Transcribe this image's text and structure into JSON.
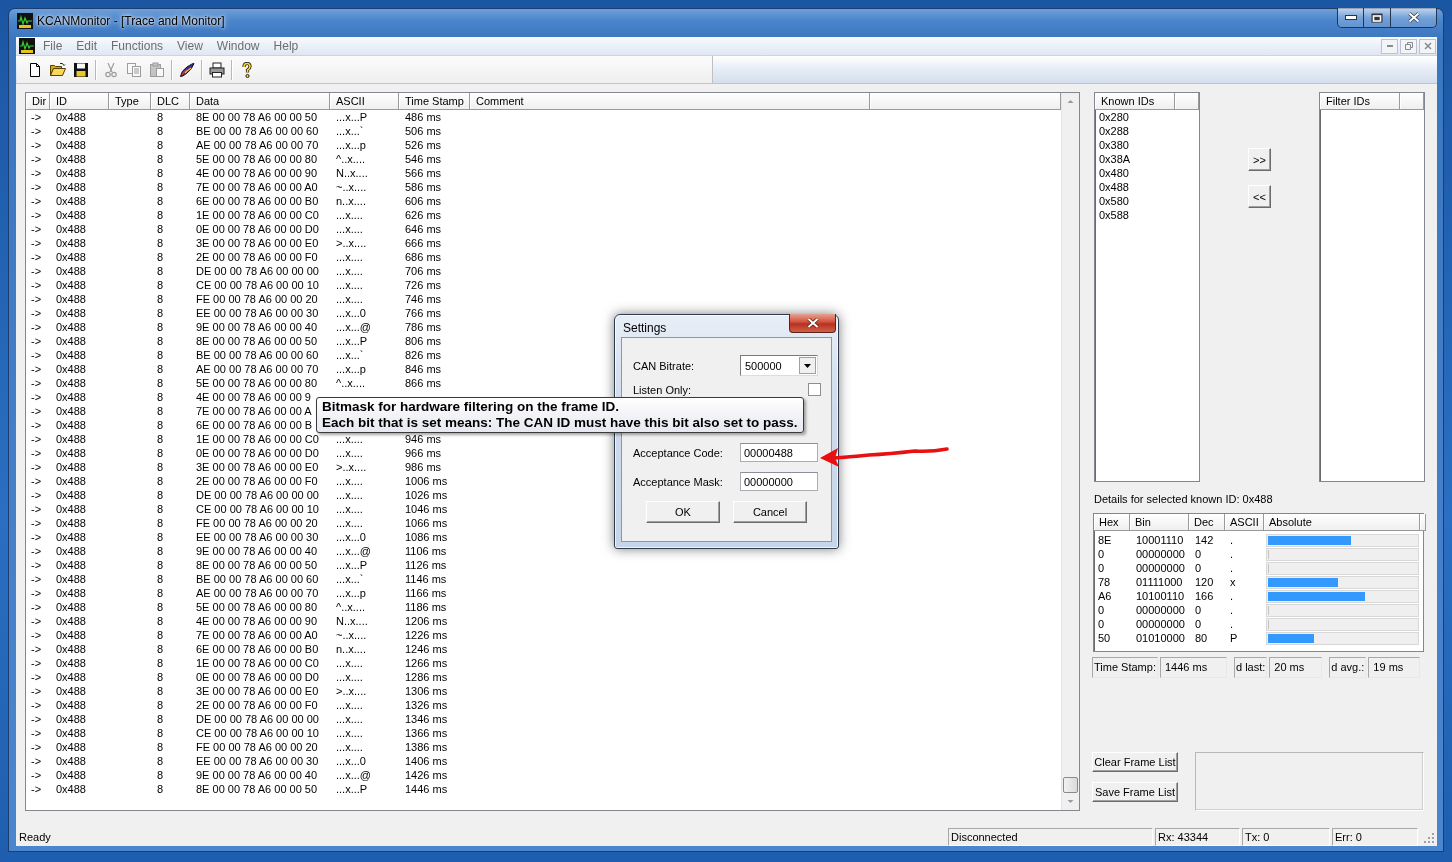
{
  "window": {
    "title": "KCANMonitor - [Trace and Monitor]"
  },
  "menu": [
    "File",
    "Edit",
    "Functions",
    "View",
    "Window",
    "Help"
  ],
  "toolbar": {
    "groups": [
      {
        "buttons": [
          {
            "disabled": false
          },
          {
            "disabled": false
          },
          {
            "disabled": false
          }
        ]
      },
      {
        "buttons": [
          {
            "disabled": true
          },
          {
            "disabled": true
          },
          {
            "disabled": true
          }
        ]
      },
      {
        "buttons": [
          {
            "disabled": false
          }
        ]
      },
      {
        "buttons": [
          {
            "disabled": false
          }
        ]
      },
      {
        "buttons": [
          {
            "disabled": false
          }
        ]
      }
    ]
  },
  "trace": {
    "columns": [
      "Dir",
      "ID",
      "Type",
      "DLC",
      "Data",
      "ASCII",
      "Time Stamp",
      "Comment"
    ],
    "rows": [
      {
        "dir": "->",
        "id": "0x488",
        "dlc": "8",
        "data": "8E 00 00 78 A6 00 00 50",
        "ascii": "...x...P",
        "time": "486 ms"
      },
      {
        "dir": "->",
        "id": "0x488",
        "dlc": "8",
        "data": "BE 00 00 78 A6 00 00 60",
        "ascii": "...x...`",
        "time": "506 ms"
      },
      {
        "dir": "->",
        "id": "0x488",
        "dlc": "8",
        "data": "AE 00 00 78 A6 00 00 70",
        "ascii": "...x...p",
        "time": "526 ms"
      },
      {
        "dir": "->",
        "id": "0x488",
        "dlc": "8",
        "data": "5E 00 00 78 A6 00 00 80",
        "ascii": "^..x....",
        "time": "546 ms"
      },
      {
        "dir": "->",
        "id": "0x488",
        "dlc": "8",
        "data": "4E 00 00 78 A6 00 00 90",
        "ascii": "N..x....",
        "time": "566 ms"
      },
      {
        "dir": "->",
        "id": "0x488",
        "dlc": "8",
        "data": "7E 00 00 78 A6 00 00 A0",
        "ascii": "~..x....",
        "time": "586 ms"
      },
      {
        "dir": "->",
        "id": "0x488",
        "dlc": "8",
        "data": "6E 00 00 78 A6 00 00 B0",
        "ascii": "n..x....",
        "time": "606 ms"
      },
      {
        "dir": "->",
        "id": "0x488",
        "dlc": "8",
        "data": "1E 00 00 78 A6 00 00 C0",
        "ascii": "...x....",
        "time": "626 ms"
      },
      {
        "dir": "->",
        "id": "0x488",
        "dlc": "8",
        "data": "0E 00 00 78 A6 00 00 D0",
        "ascii": "...x....",
        "time": "646 ms"
      },
      {
        "dir": "->",
        "id": "0x488",
        "dlc": "8",
        "data": "3E 00 00 78 A6 00 00 E0",
        "ascii": ">..x....",
        "time": "666 ms"
      },
      {
        "dir": "->",
        "id": "0x488",
        "dlc": "8",
        "data": "2E 00 00 78 A6 00 00 F0",
        "ascii": "...x....",
        "time": "686 ms"
      },
      {
        "dir": "->",
        "id": "0x488",
        "dlc": "8",
        "data": "DE 00 00 78 A6 00 00 00",
        "ascii": "...x....",
        "time": "706 ms"
      },
      {
        "dir": "->",
        "id": "0x488",
        "dlc": "8",
        "data": "CE 00 00 78 A6 00 00 10",
        "ascii": "...x....",
        "time": "726 ms"
      },
      {
        "dir": "->",
        "id": "0x488",
        "dlc": "8",
        "data": "FE 00 00 78 A6 00 00 20",
        "ascii": "...x....",
        "time": "746 ms"
      },
      {
        "dir": "->",
        "id": "0x488",
        "dlc": "8",
        "data": "EE 00 00 78 A6 00 00 30",
        "ascii": "...x...0",
        "time": "766 ms"
      },
      {
        "dir": "->",
        "id": "0x488",
        "dlc": "8",
        "data": "9E 00 00 78 A6 00 00 40",
        "ascii": "...x...@",
        "time": "786 ms"
      },
      {
        "dir": "->",
        "id": "0x488",
        "dlc": "8",
        "data": "8E 00 00 78 A6 00 00 50",
        "ascii": "...x...P",
        "time": "806 ms"
      },
      {
        "dir": "->",
        "id": "0x488",
        "dlc": "8",
        "data": "BE 00 00 78 A6 00 00 60",
        "ascii": "...x...`",
        "time": "826 ms"
      },
      {
        "dir": "->",
        "id": "0x488",
        "dlc": "8",
        "data": "AE 00 00 78 A6 00 00 70",
        "ascii": "...x...p",
        "time": "846 ms"
      },
      {
        "dir": "->",
        "id": "0x488",
        "dlc": "8",
        "data": "5E 00 00 78 A6 00 00 80",
        "ascii": "^..x....",
        "time": "866 ms"
      },
      {
        "dir": "->",
        "id": "0x488",
        "dlc": "8",
        "data": "4E 00 00 78 A6 00 00 9"
      },
      {
        "dir": "->",
        "id": "0x488",
        "dlc": "8",
        "data": "7E 00 00 78 A6 00 00 A"
      },
      {
        "dir": "->",
        "id": "0x488",
        "dlc": "8",
        "data": "6E 00 00 78 A6 00 00 B"
      },
      {
        "dir": "->",
        "id": "0x488",
        "dlc": "8",
        "data": "1E 00 00 78 A6 00 00 C0",
        "ascii": "...x....",
        "time": "946 ms"
      },
      {
        "dir": "->",
        "id": "0x488",
        "dlc": "8",
        "data": "0E 00 00 78 A6 00 00 D0",
        "ascii": "...x....",
        "time": "966 ms"
      },
      {
        "dir": "->",
        "id": "0x488",
        "dlc": "8",
        "data": "3E 00 00 78 A6 00 00 E0",
        "ascii": ">..x....",
        "time": "986 ms"
      },
      {
        "dir": "->",
        "id": "0x488",
        "dlc": "8",
        "data": "2E 00 00 78 A6 00 00 F0",
        "ascii": "...x....",
        "time": "1006 ms"
      },
      {
        "dir": "->",
        "id": "0x488",
        "dlc": "8",
        "data": "DE 00 00 78 A6 00 00 00",
        "ascii": "...x....",
        "time": "1026 ms"
      },
      {
        "dir": "->",
        "id": "0x488",
        "dlc": "8",
        "data": "CE 00 00 78 A6 00 00 10",
        "ascii": "...x....",
        "time": "1046 ms"
      },
      {
        "dir": "->",
        "id": "0x488",
        "dlc": "8",
        "data": "FE 00 00 78 A6 00 00 20",
        "ascii": "...x....",
        "time": "1066 ms"
      },
      {
        "dir": "->",
        "id": "0x488",
        "dlc": "8",
        "data": "EE 00 00 78 A6 00 00 30",
        "ascii": "...x...0",
        "time": "1086 ms"
      },
      {
        "dir": "->",
        "id": "0x488",
        "dlc": "8",
        "data": "9E 00 00 78 A6 00 00 40",
        "ascii": "...x...@",
        "time": "1106 ms"
      },
      {
        "dir": "->",
        "id": "0x488",
        "dlc": "8",
        "data": "8E 00 00 78 A6 00 00 50",
        "ascii": "...x...P",
        "time": "1126 ms"
      },
      {
        "dir": "->",
        "id": "0x488",
        "dlc": "8",
        "data": "BE 00 00 78 A6 00 00 60",
        "ascii": "...x...`",
        "time": "1146 ms"
      },
      {
        "dir": "->",
        "id": "0x488",
        "dlc": "8",
        "data": "AE 00 00 78 A6 00 00 70",
        "ascii": "...x...p",
        "time": "1166 ms"
      },
      {
        "dir": "->",
        "id": "0x488",
        "dlc": "8",
        "data": "5E 00 00 78 A6 00 00 80",
        "ascii": "^..x....",
        "time": "1186 ms"
      },
      {
        "dir": "->",
        "id": "0x488",
        "dlc": "8",
        "data": "4E 00 00 78 A6 00 00 90",
        "ascii": "N..x....",
        "time": "1206 ms"
      },
      {
        "dir": "->",
        "id": "0x488",
        "dlc": "8",
        "data": "7E 00 00 78 A6 00 00 A0",
        "ascii": "~..x....",
        "time": "1226 ms"
      },
      {
        "dir": "->",
        "id": "0x488",
        "dlc": "8",
        "data": "6E 00 00 78 A6 00 00 B0",
        "ascii": "n..x....",
        "time": "1246 ms"
      },
      {
        "dir": "->",
        "id": "0x488",
        "dlc": "8",
        "data": "1E 00 00 78 A6 00 00 C0",
        "ascii": "...x....",
        "time": "1266 ms"
      },
      {
        "dir": "->",
        "id": "0x488",
        "dlc": "8",
        "data": "0E 00 00 78 A6 00 00 D0",
        "ascii": "...x....",
        "time": "1286 ms"
      },
      {
        "dir": "->",
        "id": "0x488",
        "dlc": "8",
        "data": "3E 00 00 78 A6 00 00 E0",
        "ascii": ">..x....",
        "time": "1306 ms"
      },
      {
        "dir": "->",
        "id": "0x488",
        "dlc": "8",
        "data": "2E 00 00 78 A6 00 00 F0",
        "ascii": "...x....",
        "time": "1326 ms"
      },
      {
        "dir": "->",
        "id": "0x488",
        "dlc": "8",
        "data": "DE 00 00 78 A6 00 00 00",
        "ascii": "...x....",
        "time": "1346 ms"
      },
      {
        "dir": "->",
        "id": "0x488",
        "dlc": "8",
        "data": "CE 00 00 78 A6 00 00 10",
        "ascii": "...x....",
        "time": "1366 ms"
      },
      {
        "dir": "->",
        "id": "0x488",
        "dlc": "8",
        "data": "FE 00 00 78 A6 00 00 20",
        "ascii": "...x....",
        "time": "1386 ms"
      },
      {
        "dir": "->",
        "id": "0x488",
        "dlc": "8",
        "data": "EE 00 00 78 A6 00 00 30",
        "ascii": "...x...0",
        "time": "1406 ms"
      },
      {
        "dir": "->",
        "id": "0x488",
        "dlc": "8",
        "data": "9E 00 00 78 A6 00 00 40",
        "ascii": "...x...@",
        "time": "1426 ms"
      },
      {
        "dir": "->",
        "id": "0x488",
        "dlc": "8",
        "data": "8E 00 00 78 A6 00 00 50",
        "ascii": "...x...P",
        "time": "1446 ms"
      }
    ]
  },
  "known_ids": {
    "column": "Known IDs",
    "items": [
      {
        "label": "0x280",
        "selected": false
      },
      {
        "label": "0x288",
        "selected": false
      },
      {
        "label": "0x380",
        "selected": false
      },
      {
        "label": "0x38A",
        "selected": false
      },
      {
        "label": "0x480",
        "selected": false
      },
      {
        "label": "0x488",
        "selected": false
      },
      {
        "label": "0x580",
        "selected": false
      },
      {
        "label": "0x588",
        "selected": false
      }
    ]
  },
  "transfer_buttons": [
    ">>",
    "<<"
  ],
  "filter_ids": {
    "column": "Filter IDs"
  },
  "details": {
    "caption": "Details for selected known ID: 0x488",
    "columns": [
      "Hex",
      "Bin",
      "Dec",
      "ASCII",
      "Absolute"
    ],
    "rows": [
      {
        "hex": "8E",
        "bin": "10001110",
        "dec": "142",
        "ascii": ".",
        "level": 0.56
      },
      {
        "hex": "0",
        "bin": "00000000",
        "dec": "0",
        "ascii": ".",
        "level": 0
      },
      {
        "hex": "0",
        "bin": "00000000",
        "dec": "0",
        "ascii": ".",
        "level": 0
      },
      {
        "hex": "78",
        "bin": "01111000",
        "dec": "120",
        "ascii": "x",
        "level": 0.47
      },
      {
        "hex": "A6",
        "bin": "10100110",
        "dec": "166",
        "ascii": ".",
        "level": 0.65
      },
      {
        "hex": "0",
        "bin": "00000000",
        "dec": "0",
        "ascii": ".",
        "level": 0
      },
      {
        "hex": "0",
        "bin": "00000000",
        "dec": "0",
        "ascii": ".",
        "level": 0
      },
      {
        "hex": "50",
        "bin": "01010000",
        "dec": "80",
        "ascii": "P",
        "level": 0.31
      }
    ]
  },
  "timing": [
    {
      "label": "Time Stamp:",
      "value": "1446 ms"
    },
    {
      "label": "d last:",
      "value": "20 ms"
    },
    {
      "label": "d avg.:",
      "value": "19 ms"
    }
  ],
  "frame_buttons": [
    "Clear Frame List",
    "Save Frame List"
  ],
  "status_bar": [
    "Ready",
    "Disconnected",
    "Rx: 43344",
    "Tx: 0",
    "Err: 0"
  ],
  "dialog": {
    "title": "Settings",
    "fields": [
      {
        "kind": "dropdown",
        "label": "CAN Bitrate:",
        "value": "500000"
      },
      {
        "kind": "checkbox",
        "label": "Listen Only:",
        "checked": false
      },
      {
        "kind": "text",
        "label": "Acceptance Code:",
        "value": "00000488"
      },
      {
        "kind": "text",
        "label": "Acceptance Mask:",
        "value": "00000000"
      }
    ],
    "buttons": [
      "OK",
      "Cancel"
    ]
  },
  "tooltip": {
    "lines": [
      "Bitmask for hardware filtering on the frame ID.",
      "Each bit that is set means: The CAN ID must have this bit also set to pass."
    ]
  }
}
